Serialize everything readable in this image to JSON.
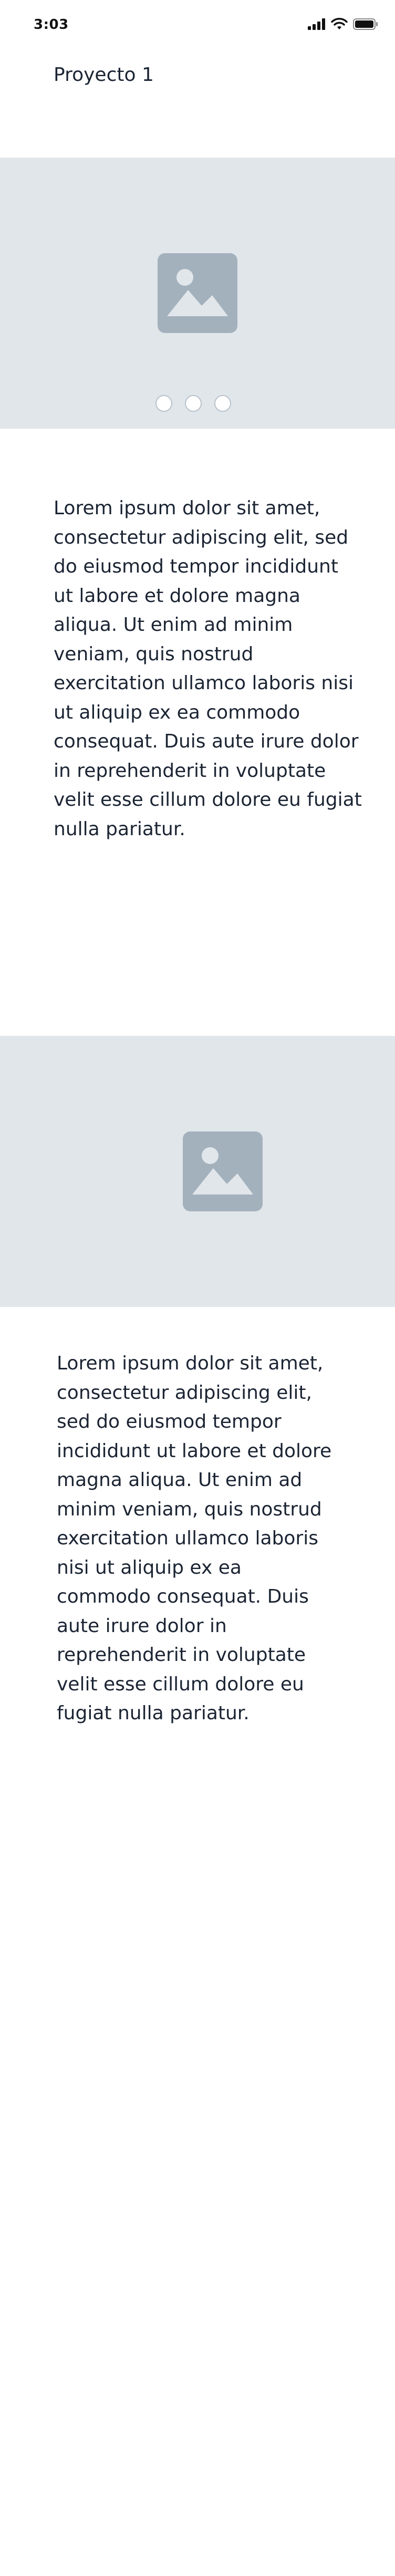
{
  "status_bar": {
    "time": "3:03",
    "icons": [
      "signal-icon",
      "wifi-icon",
      "battery-icon"
    ]
  },
  "header": {
    "title": "Proyecto 1"
  },
  "carousel": {
    "image_icon": "image-placeholder-icon",
    "dots_count": 3,
    "active_dot": null
  },
  "content": {
    "paragraph_1": "Lorem ipsum dolor sit amet, consectetur adipiscing elit, sed do eiusmod tempor incididunt ut labore et dolore magna aliqua. Ut enim ad minim veniam, quis nostrud exercitation ullamco laboris nisi ut aliquip ex ea commodo consequat. Duis aute irure dolor in reprehenderit in voluptate velit esse cillum dolore eu fugiat nulla pariatur.",
    "image_2_icon": "image-placeholder-icon",
    "paragraph_2": "Lorem ipsum dolor sit amet, consectetur adipiscing elit, sed do eiusmod tempor incididunt ut labore et dolore magna aliqua. Ut enim ad minim veniam, quis nostrud exercitation ullamco laboris nisi ut aliquip ex ea commodo consequat. Duis aute irure dolor in reprehenderit in voluptate velit esse cillum dolore eu fugiat nulla pariatur."
  },
  "colors": {
    "placeholder_bg": "#e1e6ea",
    "placeholder_icon": "#a3b1bd",
    "text": "#1b2433",
    "dot_border": "#b9c2cb"
  }
}
